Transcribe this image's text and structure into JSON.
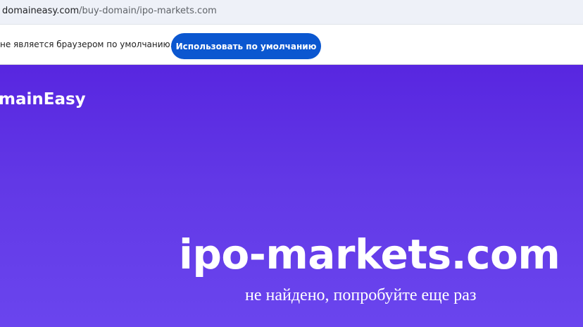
{
  "browser": {
    "address_host": "domaineasy.com",
    "address_path": "/buy-domain/ipo-markets.com"
  },
  "infobar": {
    "message": "не является браузером по умолчанию.",
    "button_label": "Использовать по умолчанию",
    "button_color": "#0b57d0"
  },
  "page": {
    "logo_text": "mainEasy",
    "domain": "ipo-markets.com",
    "status": "не найдено, попробуйте еще раз",
    "gradient_top": "#5826e0",
    "gradient_bottom": "#6a45ee"
  }
}
